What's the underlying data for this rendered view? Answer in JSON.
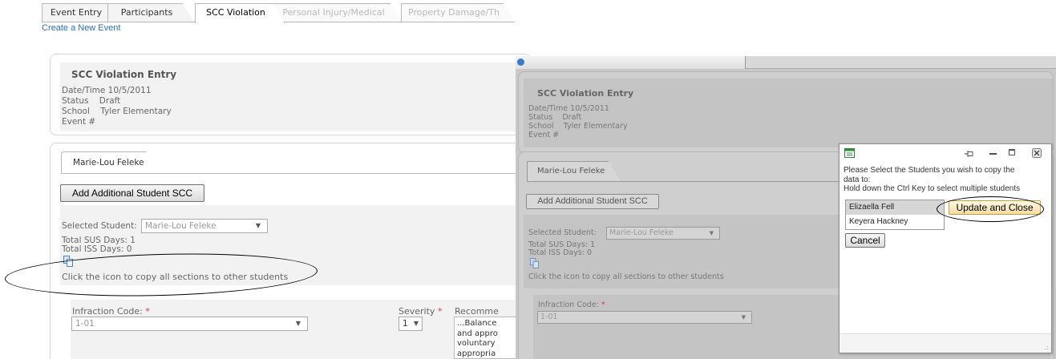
{
  "tabs": [
    {
      "label": "Event Entry",
      "state": "normal"
    },
    {
      "label": "Participants",
      "state": "normal"
    },
    {
      "label": "SCC Violation",
      "state": "active"
    },
    {
      "label": "Personal Injury/Medical",
      "state": "disabled"
    },
    {
      "label": "Property Damage/Th",
      "state": "disabled"
    }
  ],
  "create_link": "Create a New Event",
  "entry": {
    "title": "SCC Violation Entry",
    "lines": [
      "Date/Time 10/5/2011",
      "Status    Draft",
      "School    Tyler Elementary",
      "Event #"
    ]
  },
  "student_tab": "Marie-Lou Feleke",
  "add_button": "Add Additional Student SCC",
  "selected_student_label": "Selected Student:",
  "selected_student_value": "Marie-Lou Feleke",
  "total_sus": "Total SUS Days: 1",
  "total_iss": "Total ISS Days: 0",
  "copy_hint": "Click the icon to copy all sections to other students",
  "infraction_label": "Infraction Code:",
  "infraction_value": "1-01",
  "severity_label": "Severity",
  "severity_value": "1",
  "recommend_label": "Recomme",
  "recommend_text": [
    "...Balance",
    "and appro",
    "voluntary",
    "appropria"
  ],
  "required_mark": "*",
  "right_window": {
    "entry": {
      "title": "SCC Violation Entry",
      "lines": [
        "Date/Time 10/5/2011",
        "Status    Draft",
        "School    Tyler Elementary",
        "Event #"
      ]
    },
    "student_tab": "Marie-Lou Feleke",
    "add_button": "Add Additional Student SCC",
    "selected_student_label": "Selected Student:",
    "selected_student_value": "Marie-Lou Feleke",
    "total_sus": "Total SUS Days: 1",
    "total_iss": "Total ISS Days: 0",
    "copy_hint": "Click the icon to copy all sections to other students",
    "infraction_label": "Infraction Code:",
    "infraction_value": "1-01"
  },
  "dialog": {
    "message_lines": [
      "Please Select the Students you wish to copy the",
      "data to:",
      "Hold down the Ctrl Key to select multiple students"
    ],
    "students": [
      {
        "name": "Elizaella Fell",
        "selected": true
      },
      {
        "name": "Keyera Hackney",
        "selected": false
      }
    ],
    "update_button": "Update and Close",
    "cancel_button": "Cancel"
  },
  "colors": {
    "link": "#2c6fb7",
    "required": "#e34",
    "annotation": "#000000"
  },
  "icons": [
    "copy-icon",
    "dropdown-arrow-icon",
    "window-pin-icon",
    "minimize-icon",
    "maximize-icon",
    "close-icon",
    "resize-grip-icon"
  ]
}
